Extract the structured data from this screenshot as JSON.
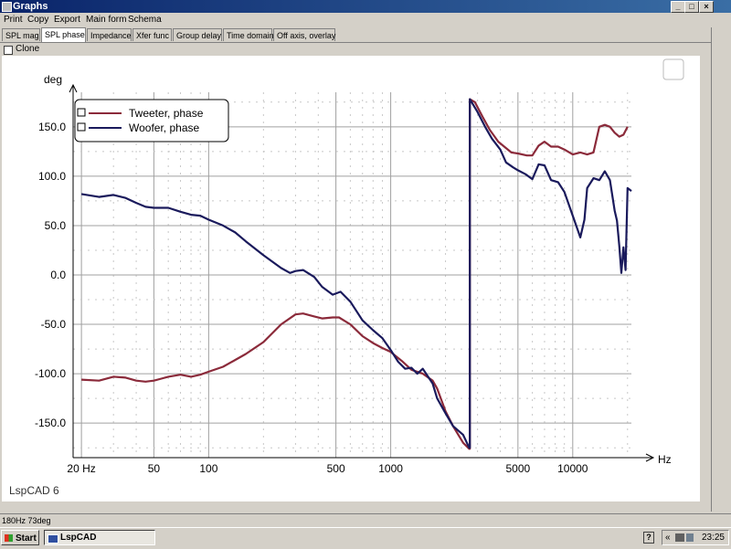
{
  "window": {
    "title": "Graphs"
  },
  "menu": [
    "Print",
    "Copy",
    "Export",
    "Main form",
    "Schema"
  ],
  "tabs": [
    {
      "label": "SPL mag",
      "active": false
    },
    {
      "label": "SPL phase",
      "active": true
    },
    {
      "label": "Impedance",
      "active": false
    },
    {
      "label": "Xfer func",
      "active": false
    },
    {
      "label": "Group delay",
      "active": false
    },
    {
      "label": "Time domain",
      "active": false
    },
    {
      "label": "Off axis, overlay",
      "active": false
    }
  ],
  "clone_label": "Clone",
  "status_text": "180Hz  73deg",
  "taskbar": {
    "start": "Start",
    "app": "LspCAD",
    "clock": "23:25",
    "help": "?"
  },
  "colors": {
    "tweeter": "#8b2a3a",
    "woofer": "#1a1a5c",
    "titlebar": "#0a246a"
  },
  "chart_data": {
    "type": "line",
    "ylabel": "deg",
    "xlabel": "Hz",
    "watermark": "LspCAD 6",
    "x_scale": "log",
    "xlim": [
      18,
      21000
    ],
    "ylim": [
      -185,
      185
    ],
    "x_ticks": [
      {
        "v": 20,
        "label": "20 Hz"
      },
      {
        "v": 50,
        "label": "50"
      },
      {
        "v": 100,
        "label": "100"
      },
      {
        "v": 500,
        "label": "500"
      },
      {
        "v": 1000,
        "label": "1000"
      },
      {
        "v": 5000,
        "label": "5000"
      },
      {
        "v": 10000,
        "label": "10000"
      }
    ],
    "y_ticks": [
      150,
      100,
      50,
      0,
      -50,
      -100,
      -150
    ],
    "y_tick_labels": [
      "150.0",
      "100.0",
      "50.0",
      "0.0",
      "-50.0",
      "-100.0",
      "-150.0"
    ],
    "grid": true,
    "legend": "top-left",
    "series": [
      {
        "name": "Tweeter, phase",
        "color": "#8b2a3a",
        "points": [
          [
            20,
            -106
          ],
          [
            25,
            -107
          ],
          [
            30,
            -103
          ],
          [
            35,
            -104
          ],
          [
            40,
            -107
          ],
          [
            45,
            -108
          ],
          [
            50,
            -107
          ],
          [
            55,
            -105
          ],
          [
            60,
            -103
          ],
          [
            70,
            -101
          ],
          [
            80,
            -103
          ],
          [
            90,
            -101
          ],
          [
            100,
            -98
          ],
          [
            120,
            -93
          ],
          [
            140,
            -86
          ],
          [
            160,
            -80
          ],
          [
            200,
            -68
          ],
          [
            250,
            -50
          ],
          [
            300,
            -40
          ],
          [
            330,
            -39
          ],
          [
            380,
            -42
          ],
          [
            420,
            -44
          ],
          [
            480,
            -43
          ],
          [
            520,
            -43
          ],
          [
            600,
            -50
          ],
          [
            700,
            -62
          ],
          [
            800,
            -69
          ],
          [
            900,
            -74
          ],
          [
            1000,
            -78
          ],
          [
            1150,
            -87
          ],
          [
            1300,
            -96
          ],
          [
            1500,
            -100
          ],
          [
            1700,
            -107
          ],
          [
            1800,
            -115
          ],
          [
            2000,
            -138
          ],
          [
            2200,
            -153
          ],
          [
            2500,
            -170
          ],
          [
            2700,
            -176
          ],
          [
            2720,
            178
          ],
          [
            2900,
            175
          ],
          [
            3200,
            160
          ],
          [
            3500,
            147
          ],
          [
            3900,
            135
          ],
          [
            4200,
            130
          ],
          [
            4600,
            124
          ],
          [
            5000,
            123
          ],
          [
            5600,
            121
          ],
          [
            6000,
            121
          ],
          [
            6500,
            131
          ],
          [
            7000,
            135
          ],
          [
            7600,
            130
          ],
          [
            8300,
            130
          ],
          [
            9000,
            127
          ],
          [
            10000,
            122
          ],
          [
            11000,
            124
          ],
          [
            12000,
            122
          ],
          [
            13000,
            124
          ],
          [
            14000,
            150
          ],
          [
            15000,
            152
          ],
          [
            16000,
            150
          ],
          [
            17000,
            144
          ],
          [
            18000,
            140
          ],
          [
            19000,
            142
          ],
          [
            20000,
            150
          ]
        ]
      },
      {
        "name": "Woofer, phase",
        "color": "#1a1a5c",
        "points": [
          [
            20,
            82
          ],
          [
            25,
            79
          ],
          [
            30,
            81
          ],
          [
            35,
            78
          ],
          [
            40,
            73
          ],
          [
            45,
            69
          ],
          [
            50,
            68
          ],
          [
            60,
            68
          ],
          [
            70,
            64
          ],
          [
            80,
            61
          ],
          [
            90,
            60
          ],
          [
            100,
            56
          ],
          [
            120,
            50
          ],
          [
            140,
            43
          ],
          [
            160,
            34
          ],
          [
            200,
            20
          ],
          [
            250,
            7
          ],
          [
            280,
            2
          ],
          [
            300,
            4
          ],
          [
            330,
            5
          ],
          [
            380,
            -2
          ],
          [
            420,
            -12
          ],
          [
            480,
            -20
          ],
          [
            530,
            -17
          ],
          [
            600,
            -27
          ],
          [
            700,
            -46
          ],
          [
            800,
            -56
          ],
          [
            900,
            -64
          ],
          [
            1000,
            -76
          ],
          [
            1100,
            -88
          ],
          [
            1200,
            -95
          ],
          [
            1300,
            -94
          ],
          [
            1400,
            -100
          ],
          [
            1500,
            -95
          ],
          [
            1700,
            -110
          ],
          [
            1800,
            -125
          ],
          [
            2000,
            -140
          ],
          [
            2200,
            -153
          ],
          [
            2500,
            -162
          ],
          [
            2700,
            -175
          ],
          [
            2720,
            178
          ],
          [
            3000,
            165
          ],
          [
            3300,
            150
          ],
          [
            3600,
            138
          ],
          [
            4000,
            127
          ],
          [
            4300,
            114
          ],
          [
            4700,
            109
          ],
          [
            5000,
            106
          ],
          [
            5500,
            102
          ],
          [
            6000,
            97
          ],
          [
            6500,
            112
          ],
          [
            7000,
            111
          ],
          [
            7600,
            96
          ],
          [
            8300,
            94
          ],
          [
            9000,
            84
          ],
          [
            10000,
            60
          ],
          [
            11000,
            38
          ],
          [
            11600,
            56
          ],
          [
            12000,
            88
          ],
          [
            13000,
            98
          ],
          [
            14000,
            96
          ],
          [
            15000,
            105
          ],
          [
            16000,
            96
          ],
          [
            17000,
            65
          ],
          [
            17500,
            55
          ],
          [
            18000,
            30
          ],
          [
            18500,
            2
          ],
          [
            19000,
            28
          ],
          [
            19500,
            5
          ],
          [
            20000,
            88
          ],
          [
            21000,
            85
          ]
        ]
      }
    ]
  }
}
